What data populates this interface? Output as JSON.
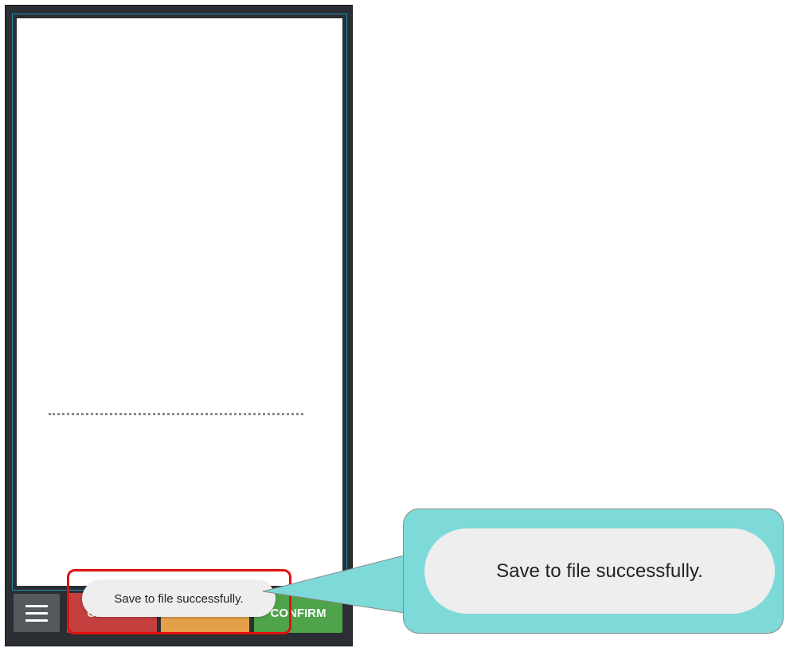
{
  "toolbar": {
    "cancel_label": "CANCEL",
    "clear_label": "CLEAR",
    "confirm_label": "CONFIRM",
    "menu_icon": "hamburger-menu-icon"
  },
  "toast": {
    "message": "Save to file successfully."
  },
  "callout": {
    "message": "Save to file successfully."
  },
  "colors": {
    "cancel": "#c63f3f",
    "clear": "#e3a048",
    "confirm": "#4fa34a",
    "canvas_border": "#1f8fb5",
    "highlight": "#e01010",
    "callout_bg": "#7ddad8"
  }
}
